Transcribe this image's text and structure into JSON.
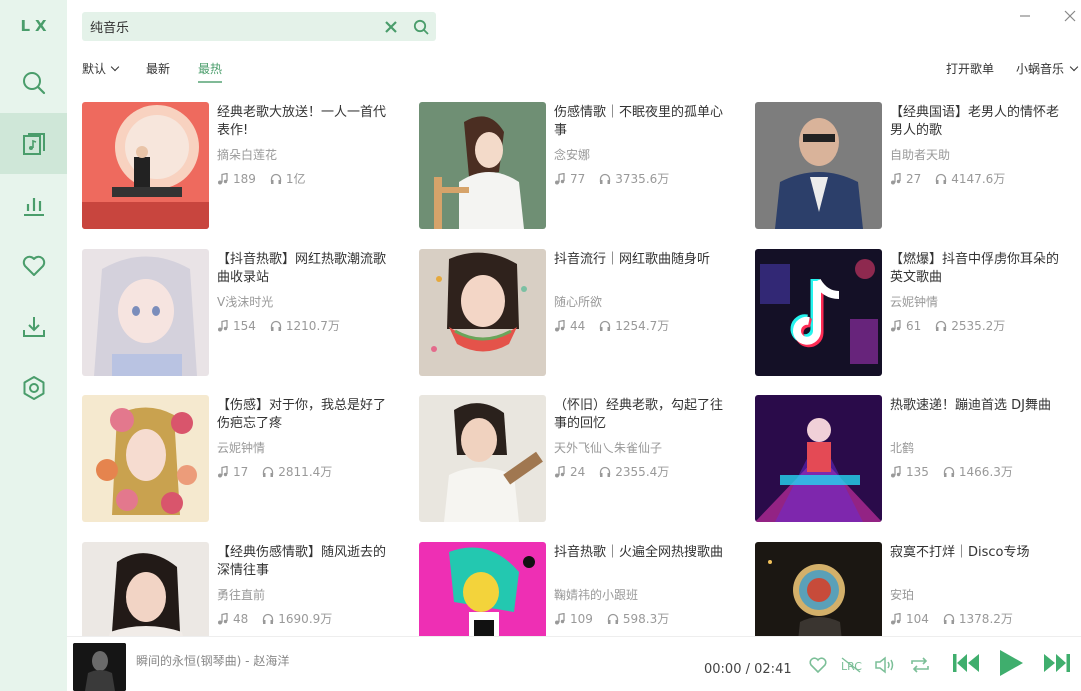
{
  "app": {
    "logo": "LX"
  },
  "sidebar": {
    "items": [
      {
        "icon": "search-icon"
      },
      {
        "icon": "song-list-icon",
        "active": true
      },
      {
        "icon": "leaderboard-icon"
      },
      {
        "icon": "heart-icon"
      },
      {
        "icon": "download-icon"
      },
      {
        "icon": "settings-icon"
      }
    ]
  },
  "search": {
    "value": "纯音乐"
  },
  "sort": {
    "tabs": [
      "默认",
      "最新",
      "最热"
    ],
    "active": 2
  },
  "toolbar": {
    "open_list": "打开歌单",
    "source": "小蜗音乐"
  },
  "playlists": [
    {
      "title": "经典老歌大放送！一人一首代表作!",
      "author": "摘朵白莲花",
      "songs": "189",
      "plays": "1亿"
    },
    {
      "title": "伤感情歌｜不眠夜里的孤单心事",
      "author": "念安娜",
      "songs": "77",
      "plays": "3735.6万"
    },
    {
      "title": "【经典国语】老男人的情怀老男人的歌",
      "author": "自助者天助",
      "songs": "27",
      "plays": "4147.6万"
    },
    {
      "title": "【抖音热歌】网红热歌潮流歌曲收录站",
      "author": "V浅沫时光",
      "songs": "154",
      "plays": "1210.7万"
    },
    {
      "title": "抖音流行｜网红歌曲随身听",
      "author": "随心所欲",
      "songs": "44",
      "plays": "1254.7万"
    },
    {
      "title": "【燃爆】抖音中俘虏你耳朵的英文歌曲",
      "author": "云妮钟情",
      "songs": "61",
      "plays": "2535.2万"
    },
    {
      "title": "【伤感】对于你，我总是好了伤疤忘了疼",
      "author": "云妮钟情",
      "songs": "17",
      "plays": "2811.4万"
    },
    {
      "title": "（怀旧）经典老歌，勾起了往事的回忆",
      "author": "天外飞仙乀朱雀仙子",
      "songs": "24",
      "plays": "2355.4万"
    },
    {
      "title": "热歌速递！蹦迪首选 DJ舞曲",
      "author": "北鹤",
      "songs": "135",
      "plays": "1466.3万"
    },
    {
      "title": "【经典伤感情歌】随风逝去的深情往事",
      "author": "勇往直前",
      "songs": "48",
      "plays": "1690.9万"
    },
    {
      "title": "抖音热歌｜火遍全网热搜歌曲",
      "author": "鞠婧祎的小跟班",
      "songs": "109",
      "plays": "598.3万"
    },
    {
      "title": "寂寞不打烊｜Disco专场",
      "author": "安珀",
      "songs": "104",
      "plays": "1378.2万"
    }
  ],
  "player": {
    "now_playing": "瞬间的永恒(钢琴曲) - 赵海洋",
    "current_time": "00:00",
    "separator": "/",
    "total_time": "02:41"
  },
  "colors": {
    "accent": "#4a9d6b",
    "sidebar_bg": "#e7f4ec",
    "search_bg": "#e4f2e9"
  }
}
